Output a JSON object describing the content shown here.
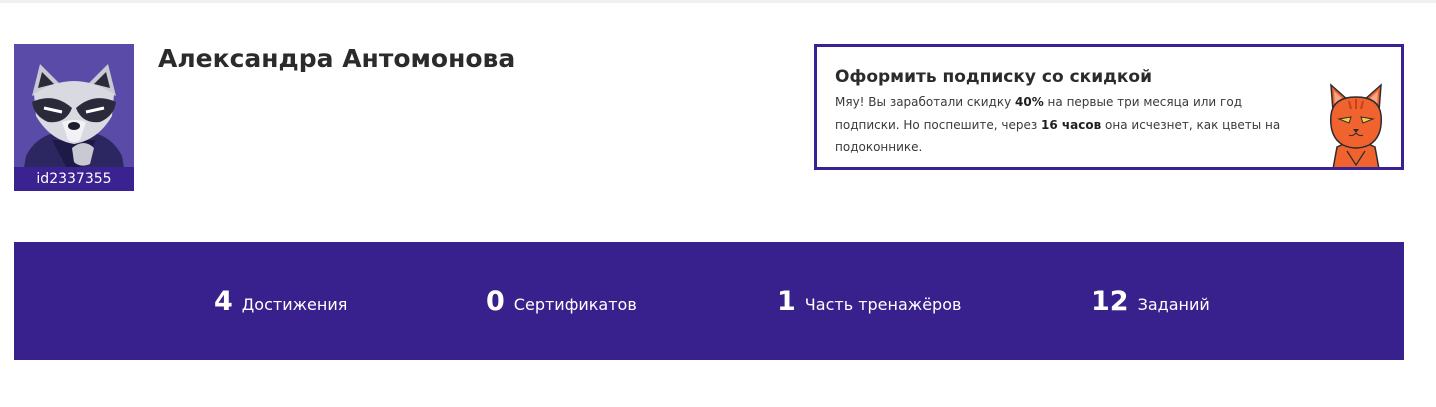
{
  "profile": {
    "user_id": "id2337355",
    "name": "Александра Антомонова"
  },
  "promo": {
    "title": "Оформить подписку со скидкой",
    "text_1": "Мяу! Вы заработали скидку ",
    "discount": "40%",
    "text_2": " на первые три месяца или год подписки. Но поспешите, через ",
    "time_left": "16 часов",
    "text_3": " она исчезнет, как цветы на подоконнике.",
    "border_color": "#3a2290"
  },
  "stats": [
    {
      "value": "4",
      "label": "Достижения"
    },
    {
      "value": "0",
      "label": "Сертификатов"
    },
    {
      "value": "1",
      "label": "Часть тренажёров"
    },
    {
      "value": "12",
      "label": "Заданий"
    }
  ],
  "colors": {
    "accent": "#38218c",
    "avatar_bg": "#5a4ba8",
    "cat_orange": "#f0622e"
  },
  "icons": {
    "avatar": "raccoon-avatar-icon",
    "promo": "cat-icon"
  }
}
